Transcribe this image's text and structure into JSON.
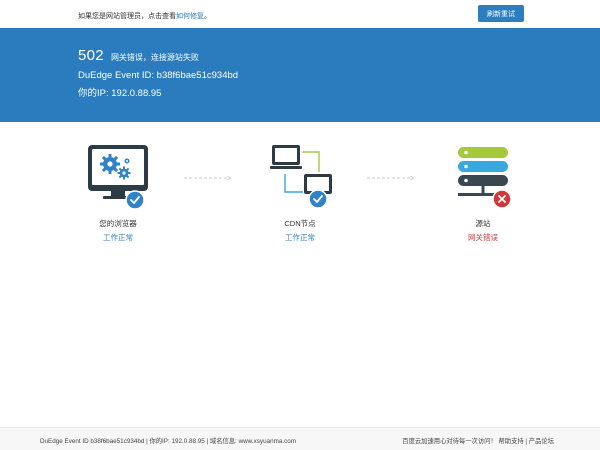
{
  "topbar": {
    "notice_prefix": "如果您是网站管理员，点击查看",
    "notice_link": "如何修复",
    "notice_suffix": "。",
    "refresh_label": "刷新重试"
  },
  "banner": {
    "code": "502",
    "description": "网关错误，连接源站失败",
    "event_id": "DuEdge Event ID: b38f6bae51c934bd",
    "ip": "你的IP: 192.0.88.95"
  },
  "nodes": [
    {
      "label": "您的浏览器",
      "status": "工作正常",
      "state": "ok",
      "icon": "browser-monitor-icon"
    },
    {
      "label": "CDN节点",
      "status": "工作正常",
      "state": "ok",
      "icon": "cdn-network-icon"
    },
    {
      "label": "源站",
      "status": "网关错误",
      "state": "error",
      "icon": "server-stack-icon"
    }
  ],
  "footer": {
    "left": "DuEdge Event ID b38f6bae51c934bd | 你的IP: 192.0.88.95 | 域名信息: www.xsyuanma.com",
    "right": "百度云加速用心对待每一次访问！ 帮助支持 | 产品论坛"
  },
  "colors": {
    "banner": "#2a7cbf",
    "ok": "#2f83c6",
    "error": "#d0393c",
    "server_green": "#a6c83c",
    "server_blue": "#37a9dd",
    "server_dark": "#3a4750"
  }
}
